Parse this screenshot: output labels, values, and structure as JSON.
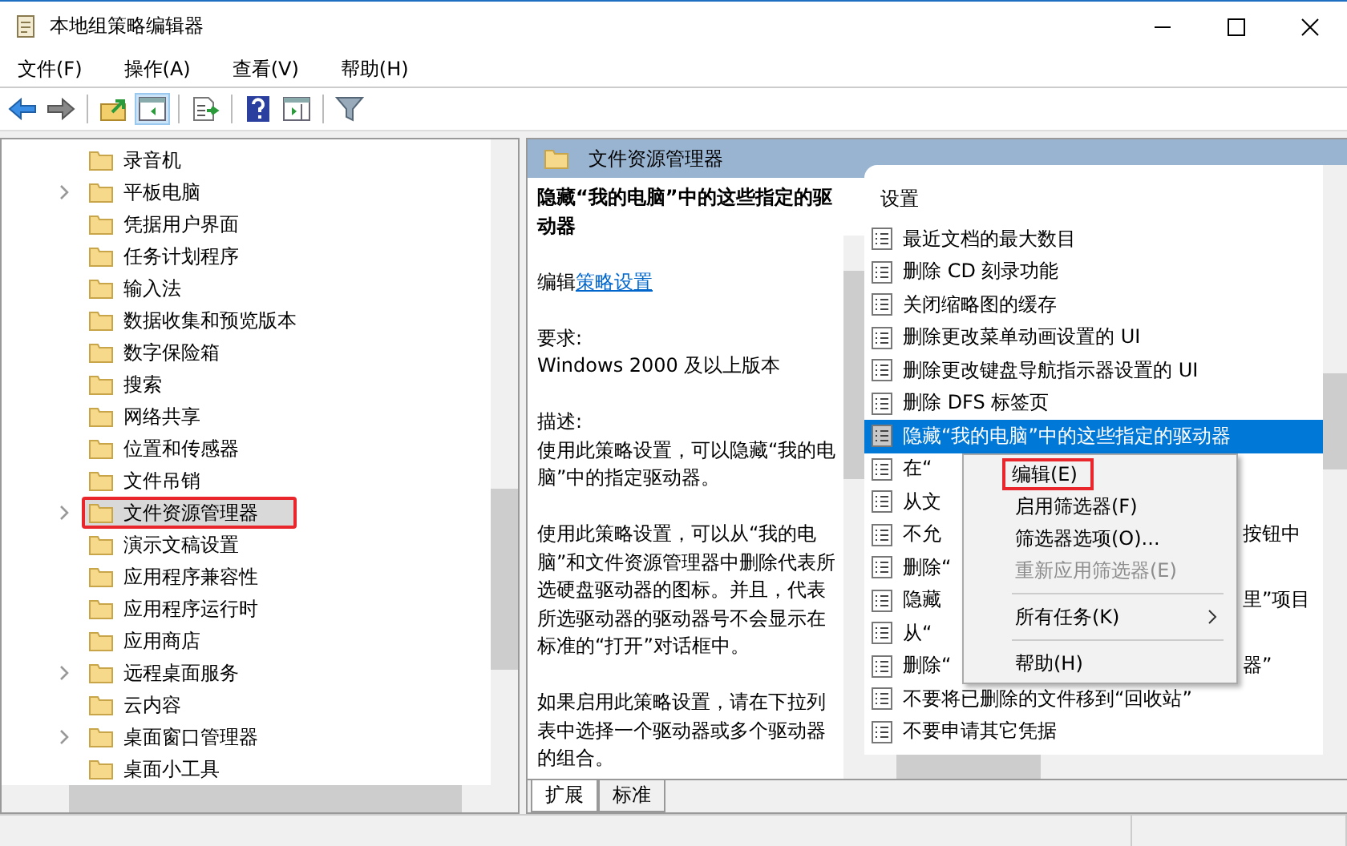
{
  "window": {
    "title": "本地组策略编辑器"
  },
  "menu_bar": [
    "文件(F)",
    "操作(A)",
    "查看(V)",
    "帮助(H)"
  ],
  "toolbar": [
    {
      "kind": "back",
      "pressed": false
    },
    {
      "kind": "forward",
      "pressed": false
    },
    {
      "kind": "up",
      "pressed": false
    },
    {
      "kind": "tree",
      "pressed": true
    },
    {
      "kind": "export",
      "pressed": false
    },
    {
      "kind": "help",
      "pressed": false
    },
    {
      "kind": "pane",
      "pressed": false
    },
    {
      "kind": "filter",
      "pressed": false
    }
  ],
  "tree": {
    "items": [
      {
        "label": "录音机",
        "expandable": false,
        "selected": false,
        "outlined": false
      },
      {
        "label": "平板电脑",
        "expandable": true,
        "selected": false,
        "outlined": false
      },
      {
        "label": "凭据用户界面",
        "expandable": false,
        "selected": false,
        "outlined": false
      },
      {
        "label": "任务计划程序",
        "expandable": false,
        "selected": false,
        "outlined": false
      },
      {
        "label": "输入法",
        "expandable": false,
        "selected": false,
        "outlined": false
      },
      {
        "label": "数据收集和预览版本",
        "expandable": false,
        "selected": false,
        "outlined": false
      },
      {
        "label": "数字保险箱",
        "expandable": false,
        "selected": false,
        "outlined": false
      },
      {
        "label": "搜索",
        "expandable": false,
        "selected": false,
        "outlined": false
      },
      {
        "label": "网络共享",
        "expandable": false,
        "selected": false,
        "outlined": false
      },
      {
        "label": "位置和传感器",
        "expandable": false,
        "selected": false,
        "outlined": false
      },
      {
        "label": "文件吊销",
        "expandable": false,
        "selected": false,
        "outlined": false
      },
      {
        "label": "文件资源管理器",
        "expandable": true,
        "selected": true,
        "outlined": true
      },
      {
        "label": "演示文稿设置",
        "expandable": false,
        "selected": false,
        "outlined": false
      },
      {
        "label": "应用程序兼容性",
        "expandable": false,
        "selected": false,
        "outlined": false
      },
      {
        "label": "应用程序运行时",
        "expandable": false,
        "selected": false,
        "outlined": false
      },
      {
        "label": "应用商店",
        "expandable": false,
        "selected": false,
        "outlined": false
      },
      {
        "label": "远程桌面服务",
        "expandable": true,
        "selected": false,
        "outlined": false
      },
      {
        "label": "云内容",
        "expandable": false,
        "selected": false,
        "outlined": false
      },
      {
        "label": "桌面窗口管理器",
        "expandable": true,
        "selected": false,
        "outlined": false
      },
      {
        "label": "桌面小工具",
        "expandable": false,
        "selected": false,
        "outlined": false
      }
    ]
  },
  "details": {
    "header": "文件资源管理器",
    "title": "隐藏“我的电脑”中的这些指定的驱动器",
    "edit_prefix": "编辑",
    "edit_link": "策略设置",
    "paragraphs": [
      [
        "要求:",
        "Windows 2000 及以上版本"
      ],
      [
        "描述:",
        "使用此策略设置，可以隐藏“我的电脑”中的指定驱动器。"
      ],
      [
        "使用此策略设置，可以从“我的电脑”和文件资源管理器中删除代表所选硬盘驱动器的图标。并且，代表所选驱动器的驱动器号不会显示在标准的“打开”对话框中。"
      ],
      [
        "如果启用此策略设置，请在下拉列表中选择一个驱动器或多个驱动器的组合。"
      ]
    ]
  },
  "settings": {
    "heading": "设置",
    "rows": [
      {
        "text": "最近文档的最大数目",
        "selected": false
      },
      {
        "text": "删除 CD 刻录功能",
        "selected": false
      },
      {
        "text": "关闭缩略图的缓存",
        "selected": false
      },
      {
        "text": "删除更改菜单动画设置的 UI",
        "selected": false
      },
      {
        "text": "删除更改键盘导航指示器设置的 UI",
        "selected": false
      },
      {
        "text": "删除 DFS 标签页",
        "selected": false
      },
      {
        "text": "隐藏“我的电脑”中的这些指定的驱动器",
        "selected": true
      },
      {
        "text": "在“",
        "selected": false
      },
      {
        "text": "从文",
        "selected": false
      },
      {
        "text": "不允",
        "tail": "按钮中",
        "selected": false
      },
      {
        "text": "删除“",
        "selected": false
      },
      {
        "text": "隐藏",
        "tail": "里”项目",
        "selected": false
      },
      {
        "text": "从“",
        "selected": false
      },
      {
        "text": "删除“",
        "tail": "器”",
        "selected": false
      },
      {
        "text": "不要将已删除的文件移到“回收站”",
        "selected": false
      },
      {
        "text": "不要申请其它凭据",
        "selected": false
      }
    ]
  },
  "context_menu": [
    {
      "kind": "item",
      "label": "编辑(E)",
      "disabled": false,
      "outlined": true
    },
    {
      "kind": "item",
      "label": "启用筛选器(F)",
      "disabled": false,
      "outlined": false
    },
    {
      "kind": "item",
      "label": "筛选器选项(O)...",
      "disabled": false,
      "outlined": false
    },
    {
      "kind": "item",
      "label": "重新应用筛选器(E)",
      "disabled": true,
      "outlined": false
    },
    {
      "kind": "separator"
    },
    {
      "kind": "submenu",
      "label": "所有任务(K)",
      "disabled": false,
      "outlined": false
    },
    {
      "kind": "separator"
    },
    {
      "kind": "item",
      "label": "帮助(H)",
      "disabled": false,
      "outlined": false
    }
  ],
  "bottom_tabs": [
    {
      "label": "扩展",
      "selected": true
    },
    {
      "label": "标准",
      "selected": false
    }
  ]
}
